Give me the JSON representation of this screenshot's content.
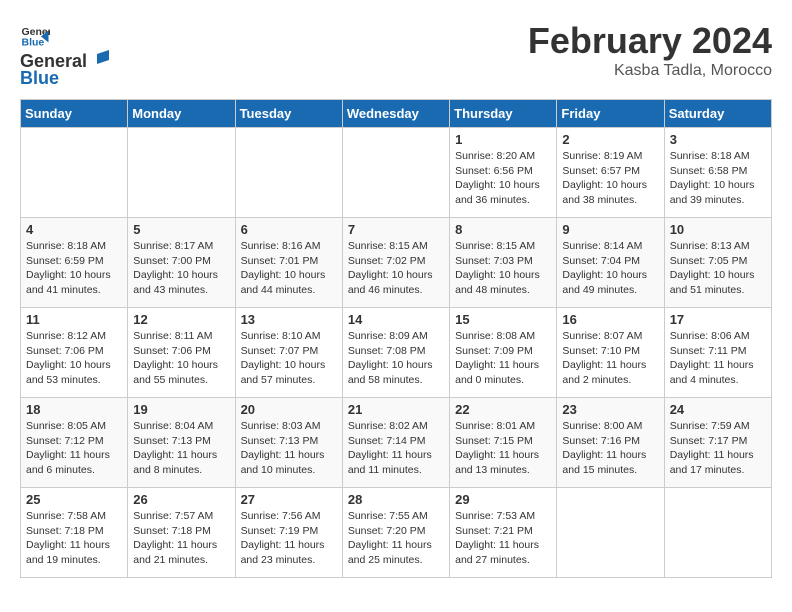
{
  "logo": {
    "general": "General",
    "blue": "Blue"
  },
  "title": "February 2024",
  "subtitle": "Kasba Tadla, Morocco",
  "days_header": [
    "Sunday",
    "Monday",
    "Tuesday",
    "Wednesday",
    "Thursday",
    "Friday",
    "Saturday"
  ],
  "weeks": [
    [
      {
        "day": "",
        "info": ""
      },
      {
        "day": "",
        "info": ""
      },
      {
        "day": "",
        "info": ""
      },
      {
        "day": "",
        "info": ""
      },
      {
        "day": "1",
        "info": "Sunrise: 8:20 AM\nSunset: 6:56 PM\nDaylight: 10 hours\nand 36 minutes."
      },
      {
        "day": "2",
        "info": "Sunrise: 8:19 AM\nSunset: 6:57 PM\nDaylight: 10 hours\nand 38 minutes."
      },
      {
        "day": "3",
        "info": "Sunrise: 8:18 AM\nSunset: 6:58 PM\nDaylight: 10 hours\nand 39 minutes."
      }
    ],
    [
      {
        "day": "4",
        "info": "Sunrise: 8:18 AM\nSunset: 6:59 PM\nDaylight: 10 hours\nand 41 minutes."
      },
      {
        "day": "5",
        "info": "Sunrise: 8:17 AM\nSunset: 7:00 PM\nDaylight: 10 hours\nand 43 minutes."
      },
      {
        "day": "6",
        "info": "Sunrise: 8:16 AM\nSunset: 7:01 PM\nDaylight: 10 hours\nand 44 minutes."
      },
      {
        "day": "7",
        "info": "Sunrise: 8:15 AM\nSunset: 7:02 PM\nDaylight: 10 hours\nand 46 minutes."
      },
      {
        "day": "8",
        "info": "Sunrise: 8:15 AM\nSunset: 7:03 PM\nDaylight: 10 hours\nand 48 minutes."
      },
      {
        "day": "9",
        "info": "Sunrise: 8:14 AM\nSunset: 7:04 PM\nDaylight: 10 hours\nand 49 minutes."
      },
      {
        "day": "10",
        "info": "Sunrise: 8:13 AM\nSunset: 7:05 PM\nDaylight: 10 hours\nand 51 minutes."
      }
    ],
    [
      {
        "day": "11",
        "info": "Sunrise: 8:12 AM\nSunset: 7:06 PM\nDaylight: 10 hours\nand 53 minutes."
      },
      {
        "day": "12",
        "info": "Sunrise: 8:11 AM\nSunset: 7:06 PM\nDaylight: 10 hours\nand 55 minutes."
      },
      {
        "day": "13",
        "info": "Sunrise: 8:10 AM\nSunset: 7:07 PM\nDaylight: 10 hours\nand 57 minutes."
      },
      {
        "day": "14",
        "info": "Sunrise: 8:09 AM\nSunset: 7:08 PM\nDaylight: 10 hours\nand 58 minutes."
      },
      {
        "day": "15",
        "info": "Sunrise: 8:08 AM\nSunset: 7:09 PM\nDaylight: 11 hours\nand 0 minutes."
      },
      {
        "day": "16",
        "info": "Sunrise: 8:07 AM\nSunset: 7:10 PM\nDaylight: 11 hours\nand 2 minutes."
      },
      {
        "day": "17",
        "info": "Sunrise: 8:06 AM\nSunset: 7:11 PM\nDaylight: 11 hours\nand 4 minutes."
      }
    ],
    [
      {
        "day": "18",
        "info": "Sunrise: 8:05 AM\nSunset: 7:12 PM\nDaylight: 11 hours\nand 6 minutes."
      },
      {
        "day": "19",
        "info": "Sunrise: 8:04 AM\nSunset: 7:13 PM\nDaylight: 11 hours\nand 8 minutes."
      },
      {
        "day": "20",
        "info": "Sunrise: 8:03 AM\nSunset: 7:13 PM\nDaylight: 11 hours\nand 10 minutes."
      },
      {
        "day": "21",
        "info": "Sunrise: 8:02 AM\nSunset: 7:14 PM\nDaylight: 11 hours\nand 11 minutes."
      },
      {
        "day": "22",
        "info": "Sunrise: 8:01 AM\nSunset: 7:15 PM\nDaylight: 11 hours\nand 13 minutes."
      },
      {
        "day": "23",
        "info": "Sunrise: 8:00 AM\nSunset: 7:16 PM\nDaylight: 11 hours\nand 15 minutes."
      },
      {
        "day": "24",
        "info": "Sunrise: 7:59 AM\nSunset: 7:17 PM\nDaylight: 11 hours\nand 17 minutes."
      }
    ],
    [
      {
        "day": "25",
        "info": "Sunrise: 7:58 AM\nSunset: 7:18 PM\nDaylight: 11 hours\nand 19 minutes."
      },
      {
        "day": "26",
        "info": "Sunrise: 7:57 AM\nSunset: 7:18 PM\nDaylight: 11 hours\nand 21 minutes."
      },
      {
        "day": "27",
        "info": "Sunrise: 7:56 AM\nSunset: 7:19 PM\nDaylight: 11 hours\nand 23 minutes."
      },
      {
        "day": "28",
        "info": "Sunrise: 7:55 AM\nSunset: 7:20 PM\nDaylight: 11 hours\nand 25 minutes."
      },
      {
        "day": "29",
        "info": "Sunrise: 7:53 AM\nSunset: 7:21 PM\nDaylight: 11 hours\nand 27 minutes."
      },
      {
        "day": "",
        "info": ""
      },
      {
        "day": "",
        "info": ""
      }
    ]
  ]
}
